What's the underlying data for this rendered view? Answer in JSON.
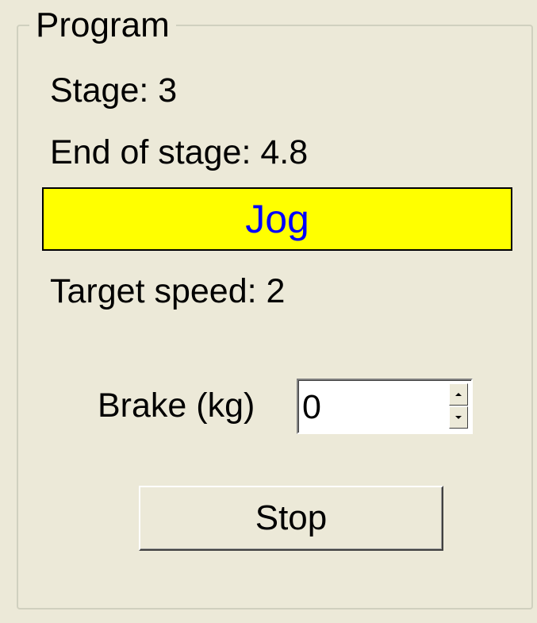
{
  "program_group": {
    "title": "Program",
    "stage_text": "Stage: 3",
    "end_of_stage_text": "End of stage: 4.8",
    "mode": {
      "label": "Jog",
      "background_color": "#ffff00",
      "text_color": "#0000ff"
    },
    "target_speed_text": "Target speed: 2",
    "brake": {
      "label": "Brake (kg)",
      "value": "0",
      "spin_icons": [
        "spin-up-arrow-icon",
        "spin-down-arrow-icon"
      ]
    },
    "stop_button_label": "Stop"
  }
}
